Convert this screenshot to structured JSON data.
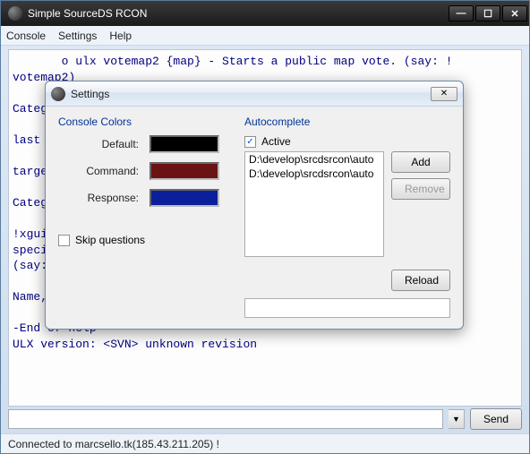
{
  "window": {
    "title": "Simple SourceDS RCON"
  },
  "menu": {
    "console": "Console",
    "settings": "Settings",
    "help": "Help"
  },
  "console": {
    "text": "       o ulx votemap2 {map} - Starts a public map vote. (say: !\nvotemap2)\n\nCateg\n                                                       t to\nlast \n\ntarge\n\nCateg\n                                                       say:\n!xgui                                                   the\nspeci\n(say:\n                                                        out\nName,                                                   an)\n\n-End of help\nULX version: <SVN> unknown revision"
  },
  "buttons": {
    "send": "Send"
  },
  "status": {
    "text": "Connected to marcsello.tk(185.43.211.205) !"
  },
  "settings": {
    "title": "Settings",
    "console_colors_label": "Console Colors",
    "default_label": "Default:",
    "command_label": "Command:",
    "response_label": "Response:",
    "colors": {
      "default": "#000000",
      "command": "#6b1313",
      "response": "#0b1f9c"
    },
    "skip_questions_label": "Skip questions",
    "skip_questions_checked": false,
    "autocomplete_label": "Autocomplete",
    "active_label": "Active",
    "active_checked": true,
    "paths": [
      "D:\\develop\\srcdsrcon\\auto",
      "D:\\develop\\srcdsrcon\\auto"
    ],
    "add_label": "Add",
    "remove_label": "Remove",
    "reload_label": "Reload"
  }
}
